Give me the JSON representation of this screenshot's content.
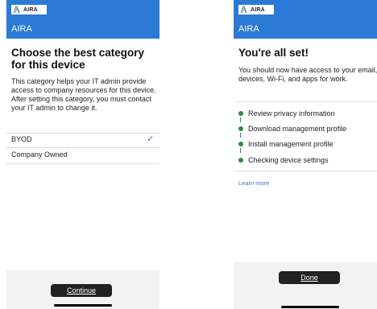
{
  "left": {
    "logo_text": "AIRA",
    "app_name": "AIRA",
    "title": "Choose the best category for this device",
    "description": "This category helps your IT admin provide access to company resources for this device. After setting this category, you must contact your IT admin to change it.",
    "options": [
      {
        "label": "BYOD",
        "selected": true
      },
      {
        "label": "Company Owned",
        "selected": false
      }
    ],
    "check_glyph": "✓",
    "button_label": "Continue"
  },
  "right": {
    "logo_text": "AIRA",
    "app_name": "AIRA",
    "title": "You're all set!",
    "description": "You should now have access to your email, devices, Wi-Fi, and apps for work.",
    "steps": [
      "Review privacy information",
      "Download management profile",
      "Install management profile",
      "Checking device settings"
    ],
    "learn_more": "Learn more",
    "button_label": "Done"
  },
  "colors": {
    "header_blue": "#2a79d4",
    "step_green": "#2e8b3e",
    "button_dark": "#222222"
  },
  "icons": {
    "logo": "aira-logo-icon",
    "check": "checkmark-icon",
    "step": "status-dot-icon"
  }
}
